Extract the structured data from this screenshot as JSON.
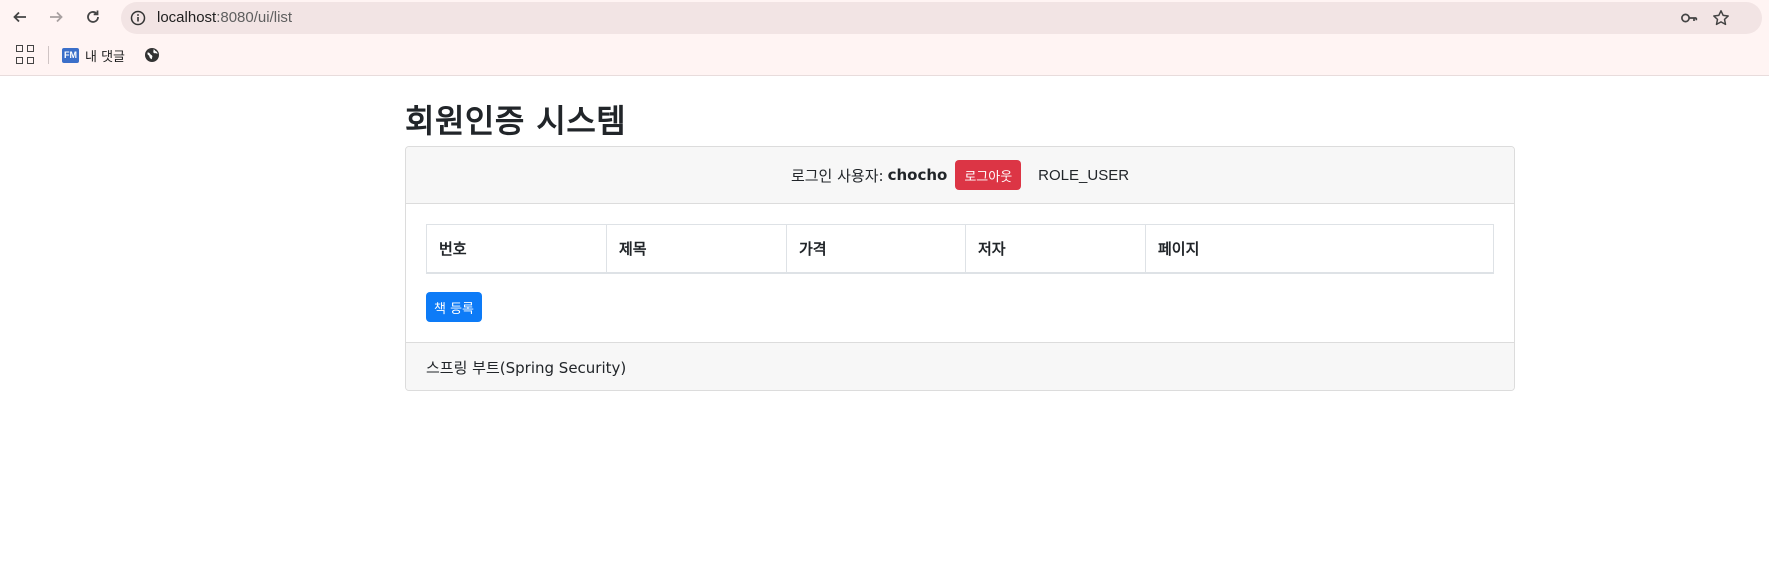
{
  "browser": {
    "url_host": "localhost",
    "url_rest": ":8080/ui/list",
    "bookmarks": [
      {
        "favicon": "FM",
        "label": "내 댓글"
      }
    ],
    "icons": {
      "back": "back-arrow-icon",
      "forward": "forward-arrow-icon",
      "reload": "reload-icon",
      "info": "info-icon",
      "key": "password-key-icon",
      "star": "bookmark-star-icon",
      "apps": "apps-grid-icon",
      "globe": "globe-icon"
    }
  },
  "page": {
    "title": "회원인증 시스템"
  },
  "header": {
    "login_label": "로그인 사용자:",
    "username": "chocho",
    "logout_label": "로그아웃",
    "role": "ROLE_USER"
  },
  "table": {
    "columns": [
      "번호",
      "제목",
      "가격",
      "저자",
      "페이지"
    ]
  },
  "actions": {
    "add_book_label": "책 등록"
  },
  "footer": {
    "text": "스프링 부트(Spring Security)"
  },
  "colors": {
    "logout_button": "#dc3545",
    "primary_button": "#0d7bf7",
    "card_header_bg": "#f7f7f7",
    "chrome_bg": "#fff4f3"
  }
}
